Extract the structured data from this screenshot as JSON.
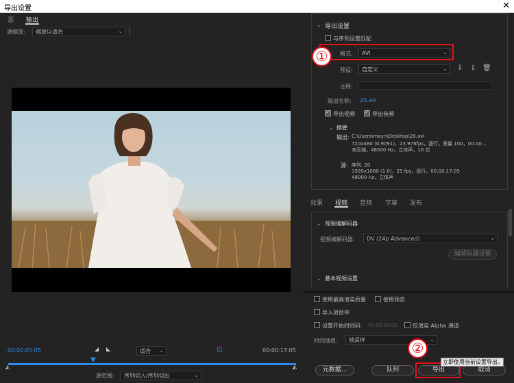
{
  "window": {
    "title": "导出设置",
    "close_glyph": "✕"
  },
  "left": {
    "tabs": [
      "源",
      "输出"
    ],
    "scale_label": "源缩放:",
    "scale_value": "缩放以适合",
    "time_start": "00:00:05:05",
    "time_end": "00:00:17:05",
    "zoom_value": "适合",
    "range_label": "源范围:",
    "range_value": "序列切入/序列切出"
  },
  "export": {
    "section_title": "导出设置",
    "match_sequence": "与序列设置匹配",
    "format_label": "格式:",
    "format_value": "AVI",
    "preset_label": "预设:",
    "preset_value": "自定义",
    "comment_label": "注释:",
    "output_name_label": "输出名称:",
    "output_name_value": "20.avi",
    "export_video": "导出视频",
    "export_audio": "导出音频",
    "summary_title": "摘要",
    "output_label": "输出:",
    "output_line1": "C:\\Users\\mayn\\Desktop\\20.avi",
    "output_line2": "720x480 (0.9091)，23.976fps，逐行，质量 100，00:00...",
    "output_line3": "未压缩，48000 Hz，立体声，16 位",
    "source_label": "源:",
    "source_line1": "序列, 20",
    "source_line2": "1920x1080 (1.0)，25 fps，逐行，00:00:17:05",
    "source_line3": "48000 Hz，立体声"
  },
  "tabs2": [
    "效果",
    "视频",
    "音频",
    "字幕",
    "发布"
  ],
  "video": {
    "codec_section": "视频编解码器",
    "codec_label": "视频编解码器:",
    "codec_value": "DV (24p Advanced)",
    "codec_settings_btn": "编解码器设置",
    "basic_section": "基本视频设置"
  },
  "bottom": {
    "max_render": "使用最高渲染质量",
    "use_preview": "使用预览",
    "import_project": "导入项目中",
    "set_start_tc": "设置开始时间码",
    "start_tc_value": "00:00:00:00",
    "alpha_only": "仅渲染 Alpha 通道",
    "interp_label": "时间插值:",
    "interp_value": "帧采样",
    "metadata_btn": "元数据...",
    "queue_btn": "队列",
    "export_btn": "导出",
    "cancel_btn": "取消",
    "tooltip": "立即使用当前设置导出。"
  },
  "annotations": {
    "one": "①",
    "two": "②"
  },
  "colors": {
    "accent_blue": "#2d8ceb",
    "highlight_red": "#e8101c"
  }
}
